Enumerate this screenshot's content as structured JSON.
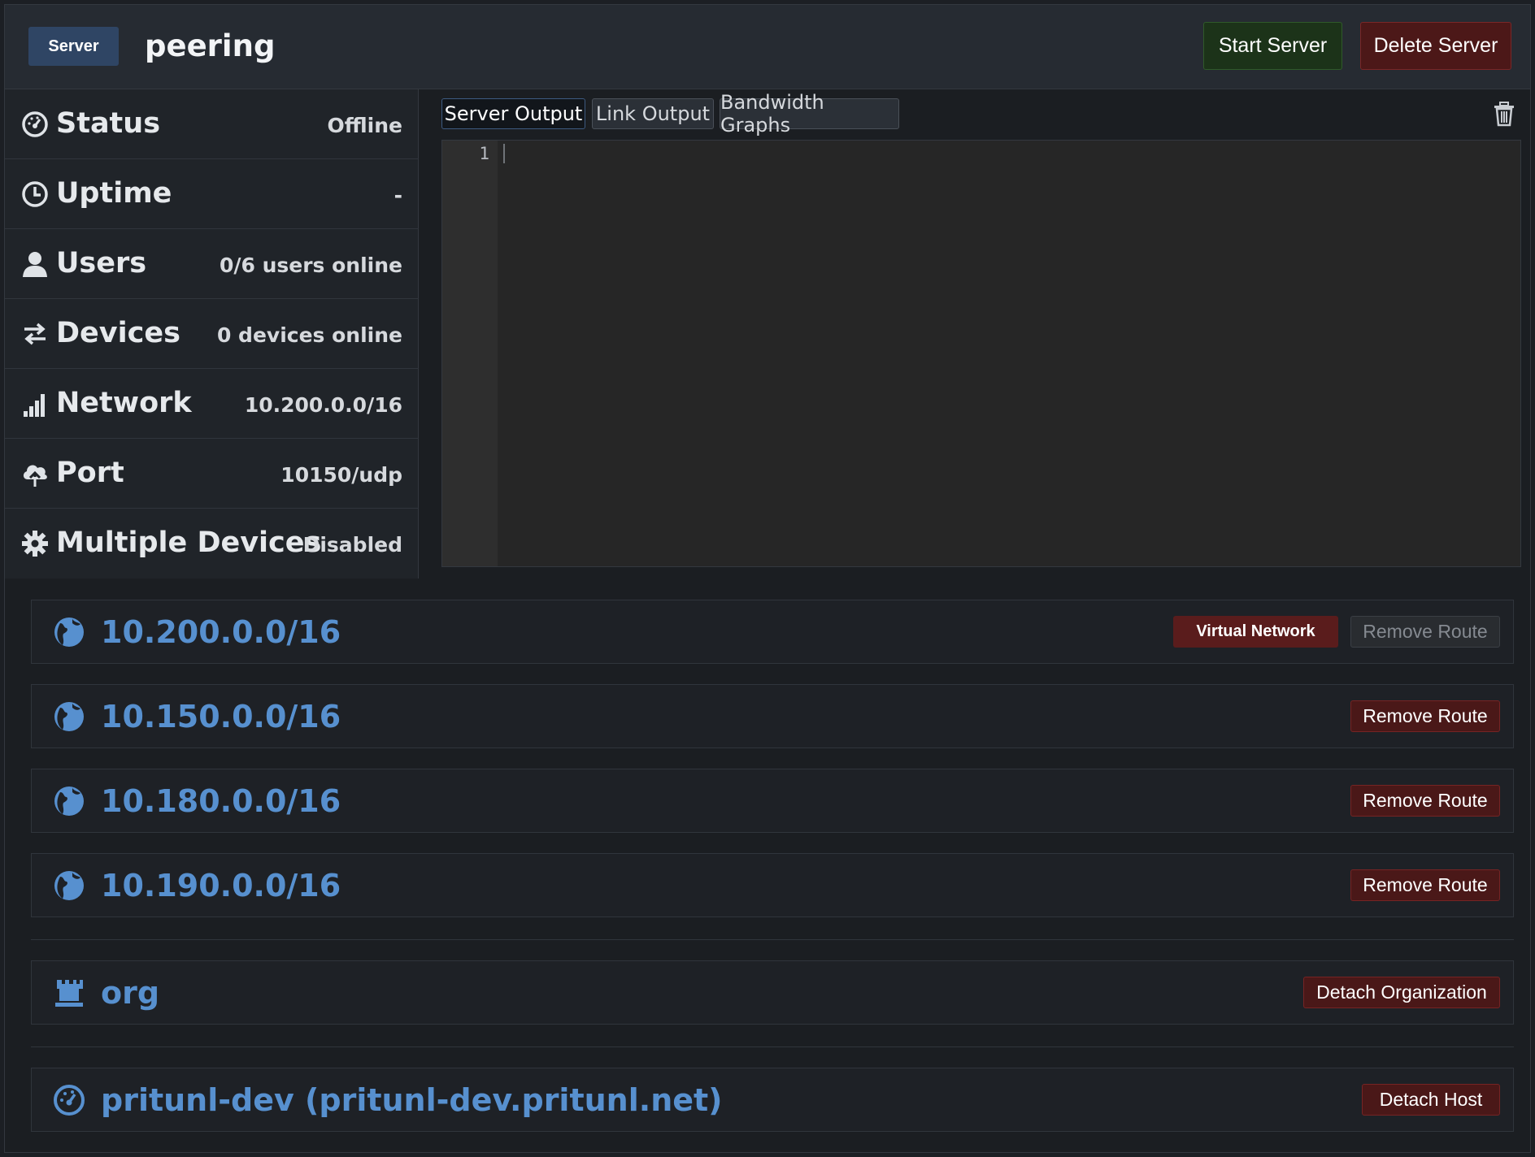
{
  "header": {
    "badge": "Server",
    "name": "peering",
    "start_label": "Start Server",
    "delete_label": "Delete Server"
  },
  "info": [
    {
      "icon": "speedometer-icon",
      "label": "Status",
      "value": "Offline"
    },
    {
      "icon": "clock-icon",
      "label": "Uptime",
      "value": "-"
    },
    {
      "icon": "user-icon",
      "label": "Users",
      "value": "0/6 users online"
    },
    {
      "icon": "transfer-arrows-icon",
      "label": "Devices",
      "value": "0 devices online"
    },
    {
      "icon": "signal-bars-icon",
      "label": "Network",
      "value": "10.200.0.0/16"
    },
    {
      "icon": "cloud-upload-icon",
      "label": "Port",
      "value": "10150/udp"
    },
    {
      "icon": "gear-icon",
      "label": "Multiple Devices",
      "value": "Disabled"
    }
  ],
  "output": {
    "tabs": [
      "Server Output",
      "Link Output",
      "Bandwidth Graphs"
    ],
    "active_tab": "Server Output",
    "line_number": "1"
  },
  "routes": [
    {
      "network": "10.200.0.0/16",
      "badge": "Virtual Network",
      "remove_label": "Remove Route",
      "remove_disabled": true
    },
    {
      "network": "10.150.0.0/16",
      "remove_label": "Remove Route"
    },
    {
      "network": "10.180.0.0/16",
      "remove_label": "Remove Route"
    },
    {
      "network": "10.190.0.0/16",
      "remove_label": "Remove Route"
    }
  ],
  "organization": {
    "name": "org",
    "detach_label": "Detach Organization"
  },
  "host": {
    "name": "pritunl-dev (pritunl-dev.pritunl.net)",
    "detach_label": "Detach Host"
  },
  "colors": {
    "link_blue": "#5790cf",
    "danger": "#4a1818",
    "success": "#1c3319",
    "badge_blue": "#2f4564"
  }
}
